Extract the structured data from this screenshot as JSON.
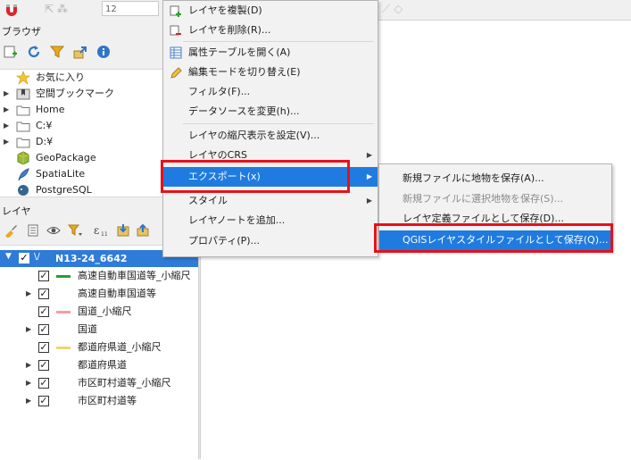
{
  "toolbar": {
    "spin_value": "12"
  },
  "browser": {
    "title": "ブラウザ",
    "items": [
      {
        "label": "お気に入り",
        "icon": "star-icon",
        "caret": ""
      },
      {
        "label": "空間ブックマーク",
        "icon": "bookmark-folder-icon",
        "caret": "▶"
      },
      {
        "label": "Home",
        "icon": "folder-icon",
        "caret": "▶"
      },
      {
        "label": "C:¥",
        "icon": "folder-icon",
        "caret": "▶"
      },
      {
        "label": "D:¥",
        "icon": "folder-icon",
        "caret": "▶"
      },
      {
        "label": "GeoPackage",
        "icon": "geopackage-icon",
        "caret": ""
      },
      {
        "label": "SpatiaLite",
        "icon": "spatialite-feather-icon",
        "caret": ""
      },
      {
        "label": "PostgreSQL",
        "icon": "postgresql-elephant-icon",
        "caret": ""
      }
    ]
  },
  "layers": {
    "title": "レイヤ",
    "group": {
      "label": "N13-24_6642",
      "caret": "▼",
      "check": "✓",
      "icon_glyph": "\\/"
    },
    "items": [
      {
        "label": "高速自動車国道等_小縮尺",
        "check": "✓",
        "color": "#2f9a2f",
        "caret": ""
      },
      {
        "label": "高速自動車国道等",
        "check": "✓",
        "color": "",
        "caret": "▶"
      },
      {
        "label": "国道_小縮尺",
        "check": "✓",
        "color": "#f2a0a0",
        "caret": ""
      },
      {
        "label": "国道",
        "check": "✓",
        "color": "",
        "caret": "▶"
      },
      {
        "label": "都道府県道_小縮尺",
        "check": "✓",
        "color": "#f5d36a",
        "caret": ""
      },
      {
        "label": "都道府県道",
        "check": "✓",
        "color": "",
        "caret": "▶"
      },
      {
        "label": "市区町村道等_小縮尺",
        "check": "✓",
        "color": "",
        "caret": "▶"
      },
      {
        "label": "市区町村道等",
        "check": "✓",
        "color": "",
        "caret": "▶"
      }
    ]
  },
  "context_menu": {
    "items": [
      {
        "label": "レイヤを複製(D)",
        "icon": "duplicate-layer-icon"
      },
      {
        "label": "レイヤを削除(R)...",
        "icon": "remove-layer-icon"
      },
      {
        "label": "属性テーブルを開く(A)",
        "icon": "attribute-table-icon"
      },
      {
        "label": "編集モードを切り替え(E)",
        "icon": "pencil-icon"
      },
      {
        "label": "フィルタ(F)...",
        "icon": ""
      },
      {
        "label": "データソースを変更(h)...",
        "icon": ""
      },
      {
        "label": "レイヤの縮尺表示を設定(V)...",
        "icon": ""
      },
      {
        "label": "レイヤのCRS",
        "icon": "",
        "arrow": "▶"
      },
      {
        "label": "エクスポート(x)",
        "icon": "",
        "arrow": "▶"
      },
      {
        "label": "スタイル",
        "icon": "",
        "arrow": "▶"
      },
      {
        "label": "レイヤノートを追加...",
        "icon": ""
      },
      {
        "label": "プロパティ(P)...",
        "icon": ""
      }
    ]
  },
  "export_submenu": {
    "items": [
      {
        "label": "新規ファイルに地物を保存(A)..."
      },
      {
        "label": "新規ファイルに選択地物を保存(S)..."
      },
      {
        "label": "レイヤ定義ファイルとして保存(D)..."
      },
      {
        "label": "QGISレイヤスタイルファイルとして保存(Q)..."
      }
    ]
  },
  "colors": {
    "highlight": "#1f7be0",
    "annotation_box": "#e8101a",
    "group_row": "#2e7bd8"
  }
}
